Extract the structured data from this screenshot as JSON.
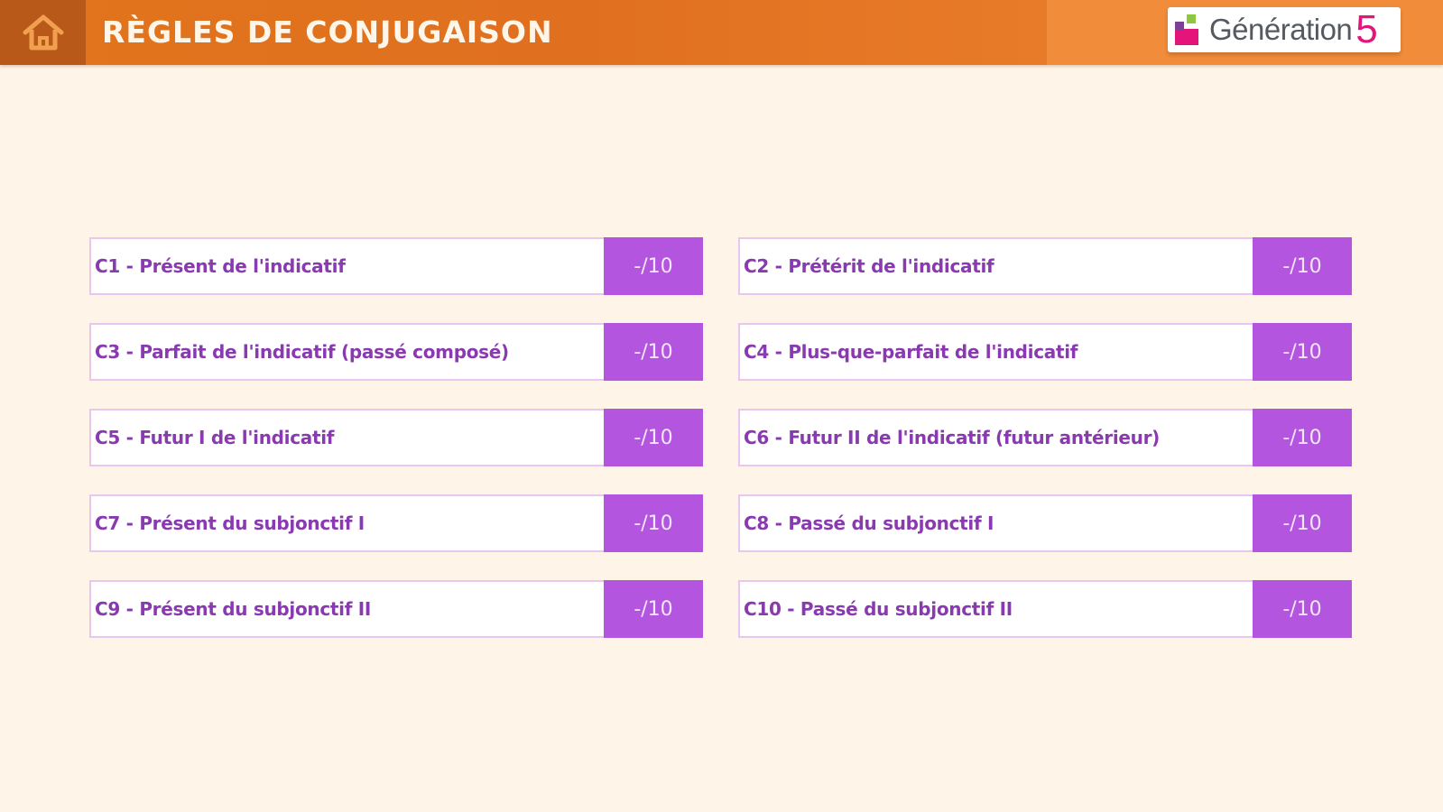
{
  "header": {
    "title": "RÈGLES DE CONJUGAISON",
    "home_icon": "home-icon",
    "logo_text": "Génération",
    "logo_number": "5"
  },
  "colors": {
    "header": "#e1741c",
    "home_button": "#b8591a",
    "background": "#fef5e8",
    "item_text": "#8a3ab0",
    "score_bg": "#b455e0",
    "item_border": "#e8c6ee",
    "logo_accent": "#e5147a"
  },
  "items": [
    {
      "label": "C1 - Présent de l'indicatif",
      "score": "-/10"
    },
    {
      "label": "C2 - Prétérit de l'indicatif",
      "score": "-/10"
    },
    {
      "label": "C3 - Parfait de l'indicatif (passé composé)",
      "score": "-/10"
    },
    {
      "label": "C4 - Plus-que-parfait de l'indicatif",
      "score": "-/10"
    },
    {
      "label": "C5 - Futur I de l'indicatif",
      "score": "-/10"
    },
    {
      "label": "C6 - Futur II de l'indicatif (futur antérieur)",
      "score": "-/10"
    },
    {
      "label": "C7 - Présent du subjonctif I",
      "score": "-/10"
    },
    {
      "label": "C8 - Passé du subjonctif I",
      "score": "-/10"
    },
    {
      "label": "C9 - Présent du subjonctif II",
      "score": "-/10"
    },
    {
      "label": "C10 - Passé du subjonctif II",
      "score": "-/10"
    }
  ]
}
